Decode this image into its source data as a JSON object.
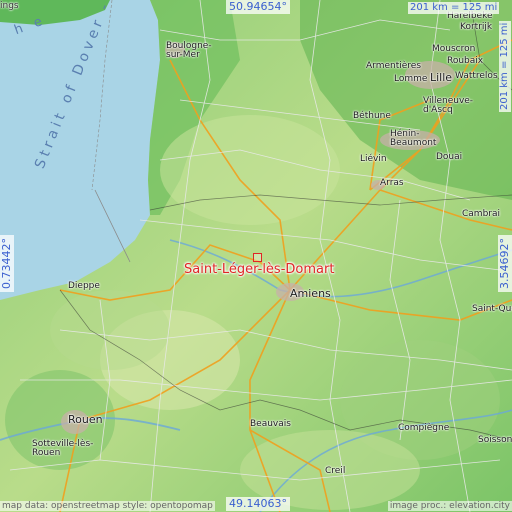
{
  "map": {
    "coords": {
      "top": "50.94654°",
      "bottom": "49.14063°",
      "left": "0.73442°",
      "right": "3.54692°"
    },
    "scale": {
      "horizontal": "201 km = 125 mi",
      "vertical": "201 km = 125 mi"
    },
    "credits": {
      "left": "map data: openstreetmap style: opentopomap",
      "right": "image proc.: elevation.city"
    },
    "target": {
      "name": "Saint-Léger-lès-Domart"
    },
    "sea": {
      "strait": "Strait of Dover - Pas",
      "fragment_ings": "ings",
      "fragment_he": "h e"
    },
    "places": {
      "boulogne": "Boulogne-sur-Mer",
      "harelbeke": "Harelbeke",
      "kortrijk": "Kortrijk",
      "mouscron": "Mouscron",
      "roubaix": "Roubaix",
      "armentieres": "Armentières",
      "lomme": "Lomme",
      "lille": "Lille",
      "wattrelos": "Wattrelos",
      "villeneuve": "Villeneuve-d'Ascq",
      "bethune": "Béthune",
      "henin": "Hénin-Beaumont",
      "lievin": "Liévin",
      "douai": "Douai",
      "arras": "Arras",
      "cambrai": "Cambrai",
      "dieppe": "Dieppe",
      "amiens": "Amiens",
      "saintquentin": "Saint-Quent",
      "rouen": "Rouen",
      "sotteville": "Sotteville-lès-Rouen",
      "beauvais": "Beauvais",
      "compiegne": "Compiègne",
      "soissons": "Soisson",
      "creil": "Creil"
    }
  }
}
